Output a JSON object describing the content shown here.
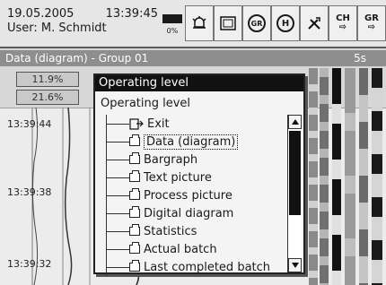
{
  "status": {
    "date": "19.05.2005",
    "time": "13:39:45",
    "user": "User: M. Schmidt",
    "memory_percent": "0%"
  },
  "toolbar": {
    "icons": [
      "memory-indicator-icon",
      "alarm-icon",
      "display-icon",
      "group-icon",
      "home-icon",
      "tools-icon",
      "channel-next-icon",
      "group-next-icon"
    ],
    "group_button_label": "GR",
    "home_button_label": "H",
    "ch_label": "CH",
    "gr_label": "GR"
  },
  "group_header": {
    "title": "Data (diagram) - Group 01",
    "interval": "5s"
  },
  "values": [
    "11.9%",
    "21.6%"
  ],
  "timestamps": [
    "13:39:44",
    "13:39:38",
    "13:39:32"
  ],
  "menu": {
    "title": "Operating level",
    "subtitle": "Operating level",
    "items": [
      {
        "label": "Exit",
        "icon": "exit-icon"
      },
      {
        "label": "Data (diagram)",
        "icon": "folder-icon",
        "selected": true
      },
      {
        "label": "Bargraph",
        "icon": "folder-icon"
      },
      {
        "label": "Text picture",
        "icon": "folder-icon"
      },
      {
        "label": "Process picture",
        "icon": "folder-icon"
      },
      {
        "label": "Digital diagram",
        "icon": "folder-icon"
      },
      {
        "label": "Statistics",
        "icon": "folder-icon"
      },
      {
        "label": "Actual batch",
        "icon": "folder-icon"
      },
      {
        "label": "Last completed batch",
        "icon": "folder-icon"
      }
    ]
  }
}
